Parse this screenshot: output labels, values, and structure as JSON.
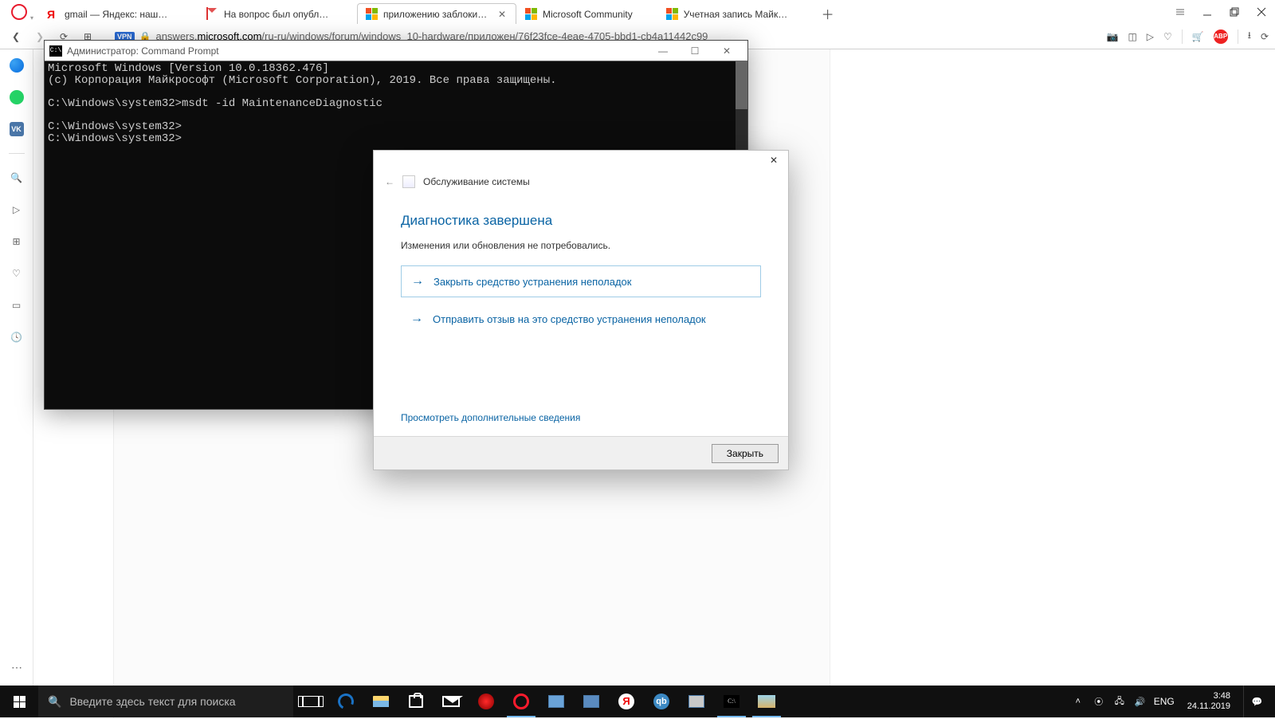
{
  "tabs": [
    {
      "label": "gmail — Яндекс: нашлось",
      "kind": "yandex"
    },
    {
      "label": "На вопрос был опубликов",
      "kind": "gmail"
    },
    {
      "label": "приложению заблокиров",
      "kind": "ms",
      "active": true
    },
    {
      "label": "Microsoft Community",
      "kind": "ms"
    },
    {
      "label": "Учетная запись Майкрос",
      "kind": "ms"
    }
  ],
  "toolbar": {
    "vpn": "VPN",
    "url_prefix": "answers.",
    "url_domain": "microsoft.com",
    "url_rest": "/ru-ru/windows/forum/windows_10-hardware/приложен/76f23fce-4eae-4705-bbd1-cb4a11442c99"
  },
  "sidebar": {
    "vk": "VK"
  },
  "cmd": {
    "title": "Администратор: Command Prompt",
    "lines": "Microsoft Windows [Version 10.0.18362.476]\n(c) Корпорация Майкрософт (Microsoft Corporation), 2019. Все права защищены.\n\nC:\\Windows\\system32>msdt -id MaintenanceDiagnostic\n\nC:\\Windows\\system32>\nC:\\Windows\\system32>"
  },
  "dialog": {
    "breadcrumb": "Обслуживание системы",
    "heading": "Диагностика завершена",
    "subtitle": "Изменения или обновления не потребовались.",
    "option1": "Закрыть средство устранения неполадок",
    "option2": "Отправить отзыв на это средство устранения неполадок",
    "more": "Просмотреть дополнительные сведения",
    "close_btn": "Закрыть"
  },
  "taskbar": {
    "search_placeholder": "Введите здесь текст для поиска",
    "lang": "ENG",
    "time": "3:48",
    "date": "24.11.2019"
  }
}
